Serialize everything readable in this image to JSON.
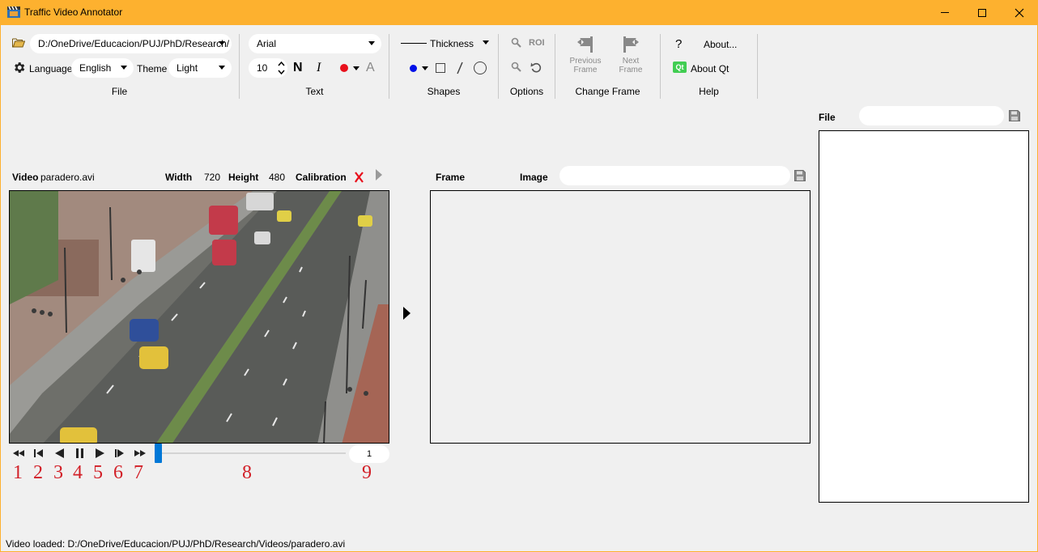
{
  "window": {
    "title": "Traffic Video Annotator"
  },
  "toolbar": {
    "file": {
      "path": "D:/OneDrive/Educacion/PUJ/PhD/Research/",
      "language_label": "Language",
      "language_value": "English",
      "theme_label": "Theme",
      "theme_value": "Light",
      "group_label": "File"
    },
    "text": {
      "font": "Arial",
      "size": "10",
      "bold_label": "N",
      "italic_label": "I",
      "color": "#e8101c",
      "font_color_label": "A",
      "group_label": "Text"
    },
    "shapes": {
      "thickness_label": "Thickness",
      "point_color": "#0010e8",
      "group_label": "Shapes"
    },
    "options": {
      "roi_label": "ROI",
      "group_label": "Options"
    },
    "change_frame": {
      "previous_label_1": "Previous",
      "previous_label_2": "Frame",
      "next_label_1": "Next",
      "next_label_2": "Frame",
      "group_label": "Change Frame"
    },
    "help": {
      "question_label": "?",
      "about_label": "About...",
      "qt_badge": "Qt",
      "about_qt_label": "About Qt",
      "group_label": "Help"
    }
  },
  "video": {
    "label": "Video",
    "filename": "paradero.avi",
    "width_label": "Width",
    "width_value": "720",
    "height_label": "Height",
    "height_value": "480",
    "calibration_label": "Calibration",
    "frame_value": "1",
    "progress": 0.0
  },
  "frame_panel": {
    "frame_label": "Frame",
    "image_label": "Image",
    "image_value": ""
  },
  "file_panel": {
    "file_label": "File",
    "file_value": ""
  },
  "annotations": [
    "1",
    "2",
    "3",
    "4",
    "5",
    "6",
    "7",
    "8",
    "9"
  ],
  "status_bar": {
    "text": "Video loaded: D:/OneDrive/Educacion/PUJ/PhD/Research/Videos/paradero.avi"
  },
  "colors": {
    "titlebar": "#fdb12f",
    "accent": "#0078d7",
    "annotation_red": "#d21f27"
  }
}
